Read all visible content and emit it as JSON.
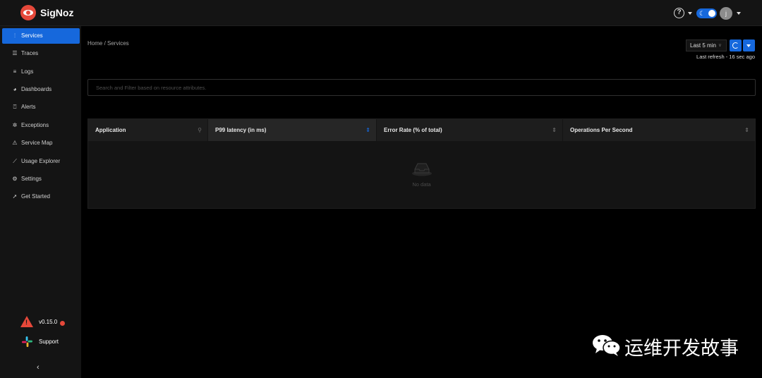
{
  "header": {
    "brand": "SigNoz",
    "help_icon": "question-circle-icon",
    "theme_toggle_icon": "moon-icon",
    "user_initial": "j",
    "accent_color": "#1668dc",
    "brand_color": "#e5483a"
  },
  "sidebar": {
    "items": [
      {
        "label": "Services",
        "icon": "bar-chart-icon",
        "glyph": "⫶",
        "active": true
      },
      {
        "label": "Traces",
        "icon": "menu-icon",
        "glyph": "☰",
        "active": false
      },
      {
        "label": "Logs",
        "icon": "align-left-icon",
        "glyph": "≡",
        "active": false
      },
      {
        "label": "Dashboards",
        "icon": "dashboard-icon",
        "glyph": "◕",
        "active": false
      },
      {
        "label": "Alerts",
        "icon": "alert-icon",
        "glyph": "⍞",
        "active": false
      },
      {
        "label": "Exceptions",
        "icon": "bug-icon",
        "glyph": "✲",
        "active": false
      },
      {
        "label": "Service Map",
        "icon": "deployment-unit-icon",
        "glyph": "⚠",
        "active": false
      },
      {
        "label": "Usage Explorer",
        "icon": "line-chart-icon",
        "glyph": "⟋",
        "active": false
      },
      {
        "label": "Settings",
        "icon": "settings-icon",
        "glyph": "⚙",
        "active": false
      },
      {
        "label": "Get Started",
        "icon": "rocket-icon",
        "glyph": "➚",
        "active": false
      }
    ],
    "version": "v0.15.0",
    "support_label": "Support",
    "collapse_glyph": "‹"
  },
  "main": {
    "breadcrumb": "Home  /  Services",
    "time_range": "Last 5 min",
    "last_refresh": "Last refresh - 16 sec ago",
    "search_placeholder": "Search and Filter based on resource attributes.",
    "table": {
      "columns": [
        "Application",
        "P99 latency (in ms)",
        "Error Rate (% of total)",
        "Operations Per Second"
      ],
      "empty_text": "No data"
    }
  },
  "watermark": {
    "text": "运维开发故事"
  }
}
